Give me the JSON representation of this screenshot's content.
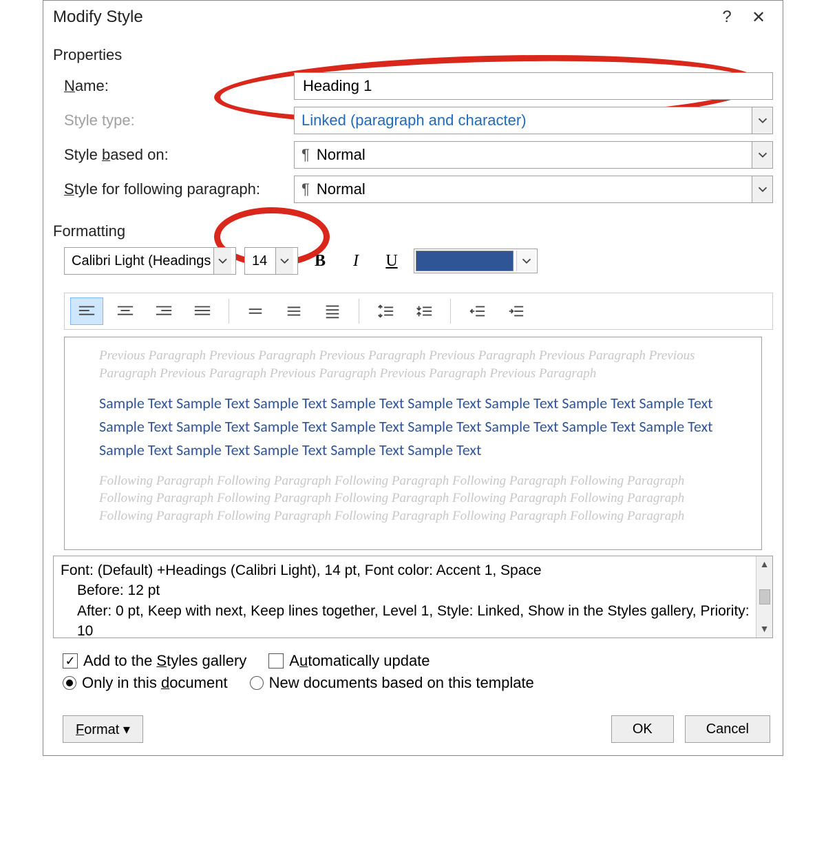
{
  "titlebar": {
    "title": "Modify Style",
    "help": "?",
    "close": "✕"
  },
  "sections": {
    "properties": "Properties",
    "formatting": "Formatting"
  },
  "properties": {
    "name_label": "Name:",
    "name_value": "Heading 1",
    "type_label": "Style type:",
    "type_value": "Linked (paragraph and character)",
    "based_label": "Style based on:",
    "based_value": "Normal",
    "following_label": "Style for following paragraph:",
    "following_value": "Normal"
  },
  "formatting": {
    "font": "Calibri Light (Headings)",
    "size": "14",
    "accent_color": "#2f5597"
  },
  "preview": {
    "prev": "Previous Paragraph Previous Paragraph Previous Paragraph Previous Paragraph Previous Paragraph Previous Paragraph Previous Paragraph Previous Paragraph Previous Paragraph Previous Paragraph",
    "sample": "Sample Text Sample Text Sample Text Sample Text Sample Text Sample Text Sample Text Sample Text Sample Text Sample Text Sample Text Sample Text Sample Text Sample Text Sample Text Sample Text Sample Text Sample Text Sample Text Sample Text Sample Text",
    "foll": "Following Paragraph Following Paragraph Following Paragraph Following Paragraph Following Paragraph Following Paragraph Following Paragraph Following Paragraph Following Paragraph Following Paragraph Following Paragraph Following Paragraph Following Paragraph Following Paragraph Following Paragraph"
  },
  "description": {
    "line1": "Font: (Default) +Headings (Calibri Light), 14 pt, Font color: Accent 1, Space",
    "line2": "Before:  12 pt",
    "line3": "After:  0 pt, Keep with next, Keep lines together, Level 1, Style: Linked, Show in the Styles gallery, Priority: 10"
  },
  "options": {
    "add_gallery": "Add to the Styles gallery",
    "auto_update": "Automatically update",
    "only_doc": "Only in this document",
    "new_template": "New documents based on this template"
  },
  "footer": {
    "format": "Format ▾",
    "ok": "OK",
    "cancel": "Cancel"
  }
}
